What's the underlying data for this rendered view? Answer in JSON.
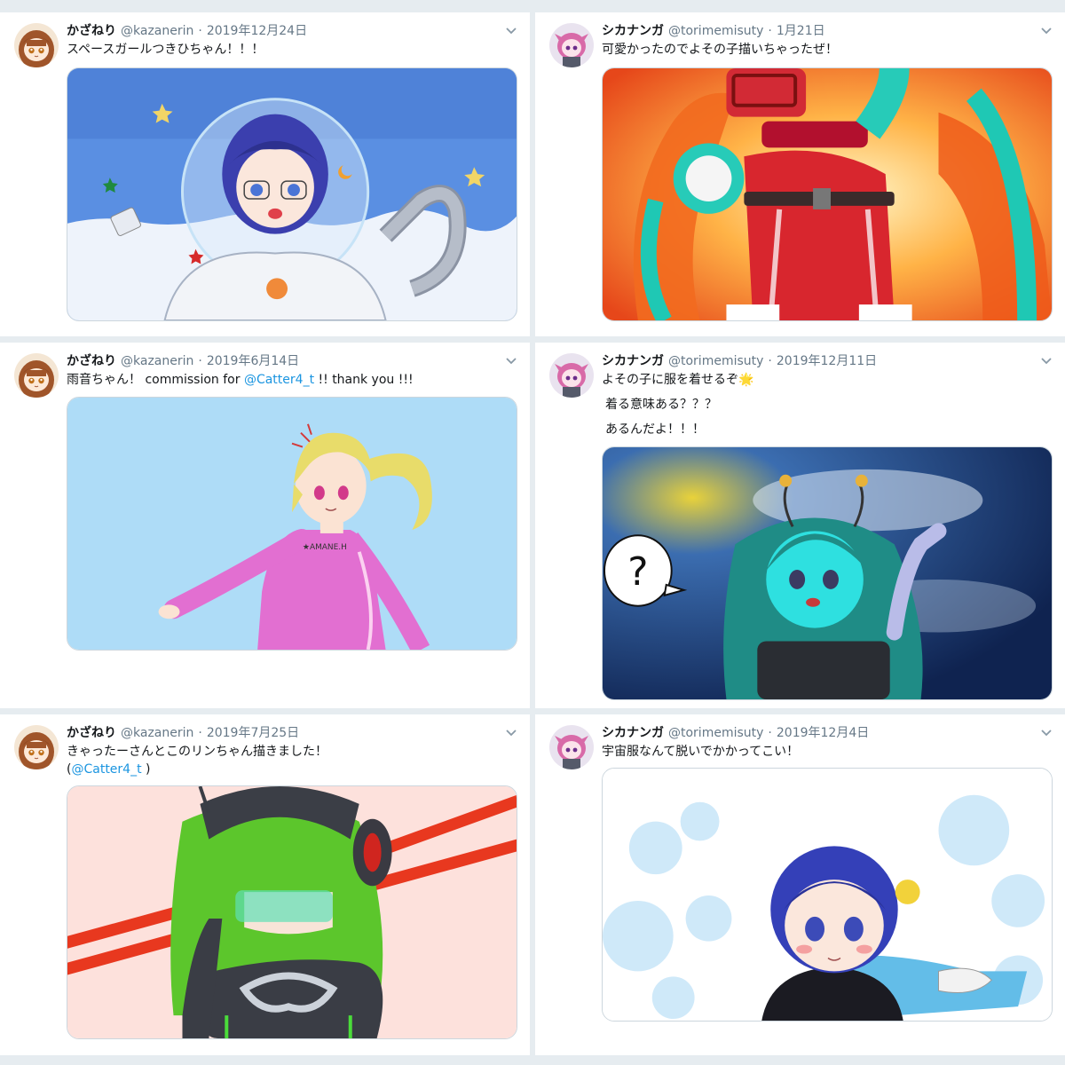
{
  "tweets": [
    {
      "name": "かざねり",
      "handle": "@kazanerin",
      "sep": "·",
      "date": "2019年12月24日",
      "text": "スペースガールつきひちゃん！！！",
      "avatar_icon": "chibi-brown-hair-avatar",
      "image_desc": "space-girl-astronaut-illustration"
    },
    {
      "name": "シカナンガ",
      "handle": "@torimemisuty",
      "sep": "·",
      "date": "1月21日",
      "text": "可愛かったのでよその子描いちゃったぜ！",
      "avatar_icon": "pink-hair-girl-avatar",
      "image_desc": "red-suit-hero-illustration"
    },
    {
      "name": "かざねり",
      "handle": "@kazanerin",
      "sep": "·",
      "date": "2019年6月14日",
      "text_pre": "雨音ちゃん！ commission for ",
      "mention": "@Catter4_t",
      "text_post": " !! thank you !!!",
      "avatar_icon": "chibi-brown-hair-avatar",
      "image_desc": "pink-bodysuit-girl-illustration"
    },
    {
      "name": "シカナンガ",
      "handle": "@torimemisuty",
      "sep": "·",
      "date": "2019年12月11日",
      "line1": "よその子に服を着せるぞ",
      "line1_emoji": "🌟",
      "line2": "着る意味ある？？？",
      "line3": "あるんだよ！！！",
      "bubble_text": "?",
      "avatar_icon": "pink-hair-girl-avatar",
      "image_desc": "green-alien-girl-illustration"
    },
    {
      "name": "かざねり",
      "handle": "@kazanerin",
      "sep": "·",
      "date": "2019年7月25日",
      "line1": "きゃったーさんとこのリンちゃん描きました！",
      "line2_pre": "(",
      "mention": "@Catter4_t",
      "line2_post": " )",
      "avatar_icon": "chibi-brown-hair-avatar",
      "image_desc": "green-hair-headset-girl-illustration"
    },
    {
      "name": "シカナンガ",
      "handle": "@torimemisuty",
      "sep": "·",
      "date": "2019年12月4日",
      "text": "宇宙服なんて脱いでかかってこい！",
      "avatar_icon": "pink-hair-girl-avatar",
      "image_desc": "blue-hair-black-suit-girl-illustration"
    }
  ],
  "colors": {
    "background": "#e6ecf0",
    "link": "#1b95e0",
    "text": "#14171a",
    "muted": "#657786"
  },
  "icons": {
    "menu": "chevron-down-icon"
  }
}
